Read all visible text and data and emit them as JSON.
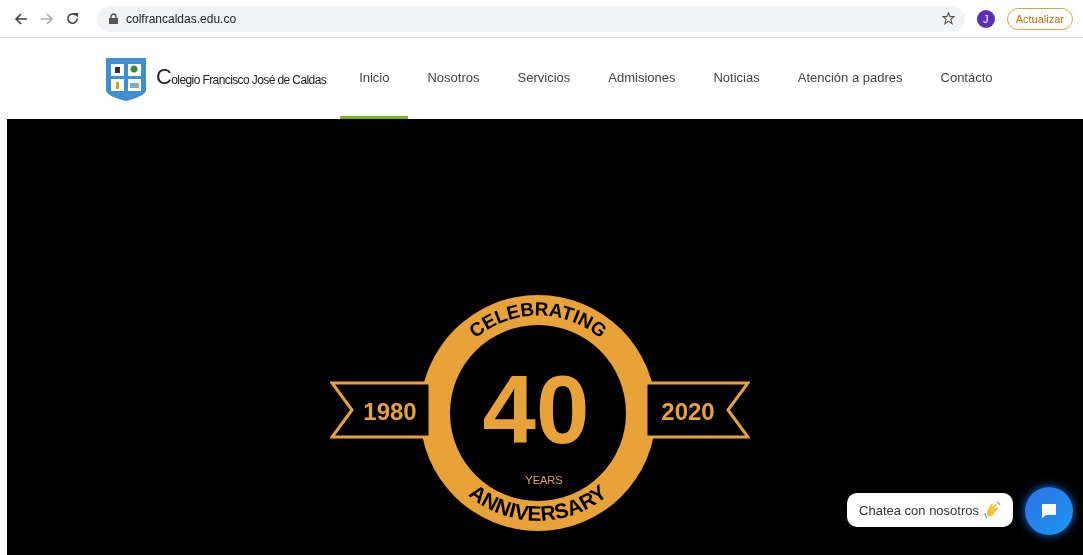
{
  "browser": {
    "url": "colfrancaldas.edu.co",
    "profile_initial": "J",
    "update_button": "Actualizar"
  },
  "site": {
    "name": "Colegio Francisco José de Caldas",
    "nav": [
      {
        "label": "Inicio",
        "selected": true
      },
      {
        "label": "Nosotros",
        "selected": false
      },
      {
        "label": "Servicios",
        "selected": false
      },
      {
        "label": "Admisiones",
        "selected": false
      },
      {
        "label": "Noticias",
        "selected": false
      },
      {
        "label": "Atención a padres",
        "selected": false
      },
      {
        "label": "Contácto",
        "selected": false
      }
    ]
  },
  "hero": {
    "emblem": {
      "top_arc": "CELEBRATING",
      "number": "40",
      "start_year": "1980",
      "end_year": "2020",
      "years": "YEARS",
      "bottom_arc": "ANNIVERSARY"
    }
  },
  "chat": {
    "label": "Chatea con nosotros"
  }
}
